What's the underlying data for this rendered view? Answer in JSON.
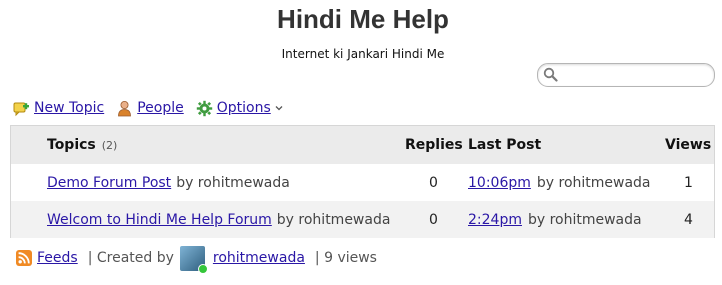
{
  "header": {
    "title": "Hindi Me Help",
    "subtitle": "Internet ki Jankari Hindi Me"
  },
  "search": {
    "placeholder": "",
    "value": ""
  },
  "toolbar": {
    "new_topic": "New Topic",
    "people": "People",
    "options": "Options"
  },
  "table": {
    "headers": {
      "topics": "Topics",
      "topics_count": "(2)",
      "replies": "Replies",
      "last_post": "Last Post",
      "views": "Views"
    },
    "rows": [
      {
        "topic": "Demo Forum Post",
        "author": "by rohitmewada",
        "replies": "0",
        "last_post_time": "10:06pm",
        "last_post_by": "by rohitmewada",
        "views": "1"
      },
      {
        "topic": "Welcom to Hindi Me Help Forum",
        "author": "by rohitmewada",
        "replies": "0",
        "last_post_time": "2:24pm",
        "last_post_by": "by rohitmewada",
        "views": "4"
      }
    ]
  },
  "footer": {
    "feeds": "Feeds",
    "created_by_label": "| Created by",
    "creator": "rohitmewada",
    "views": "| 9 views"
  },
  "icons": {
    "search": "search-icon",
    "new_topic": "new-topic-icon",
    "people": "people-icon",
    "options": "gear-icon",
    "feeds": "rss-icon"
  },
  "colors": {
    "link": "#2a17a6",
    "header_bg": "#ebebeb",
    "alt_row_bg": "#f2f2f2"
  }
}
